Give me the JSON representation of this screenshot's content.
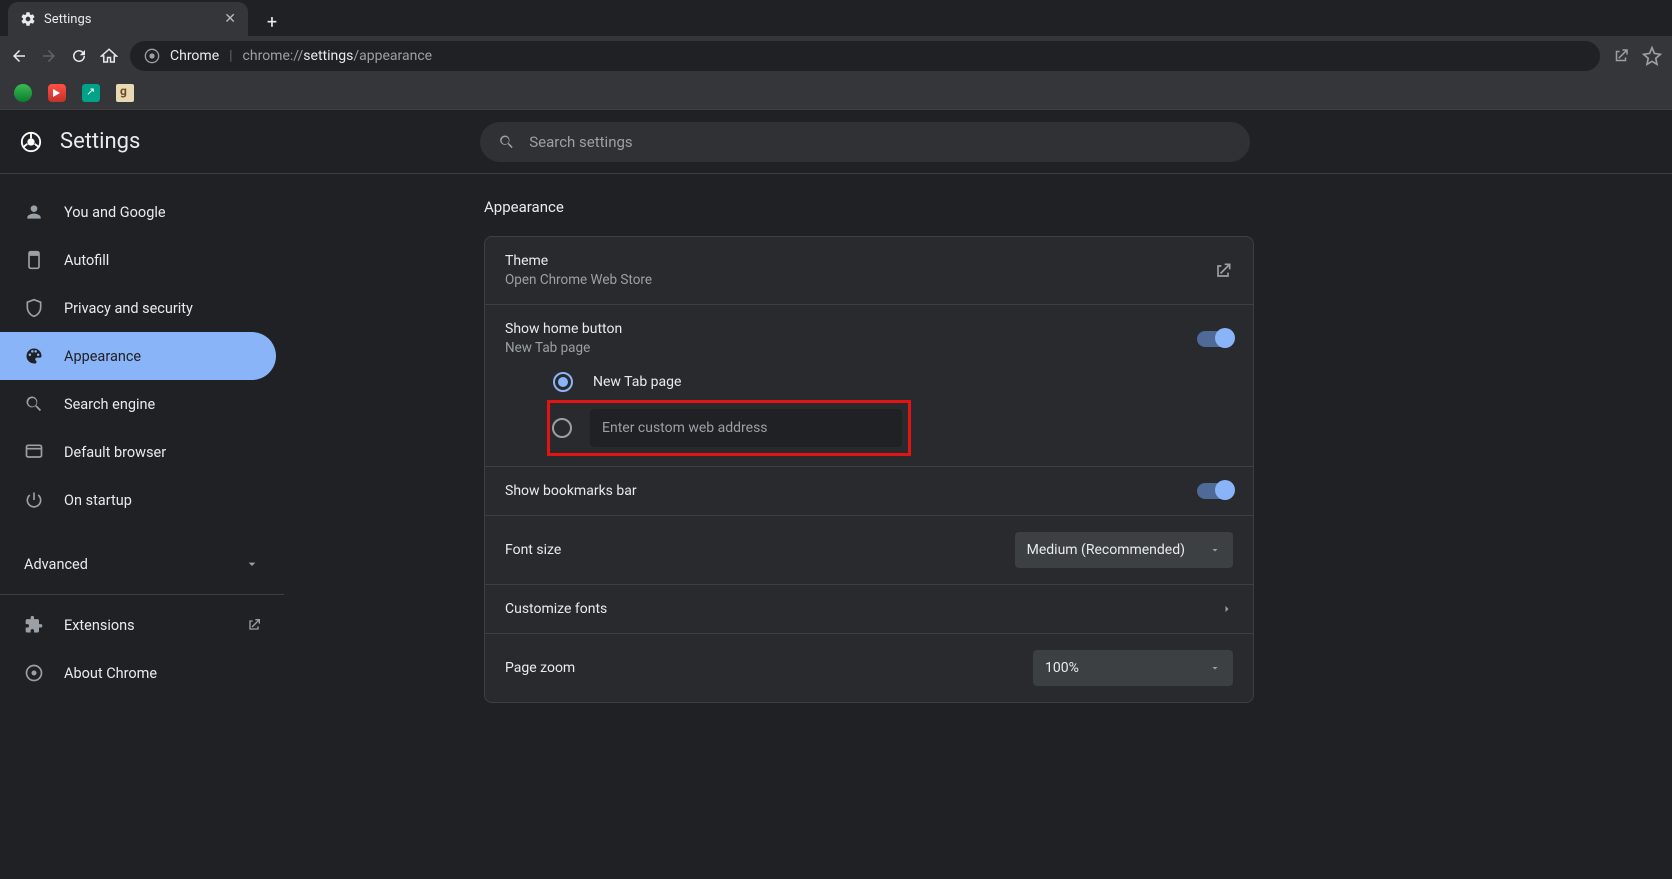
{
  "browser": {
    "tab_title": "Settings",
    "omnibox": {
      "label": "Chrome",
      "prefix": "chrome://",
      "mid": "settings",
      "suffix": "/appearance"
    }
  },
  "header": {
    "title": "Settings",
    "search_placeholder": "Search settings"
  },
  "sidebar": {
    "items": [
      {
        "label": "You and Google"
      },
      {
        "label": "Autofill"
      },
      {
        "label": "Privacy and security"
      },
      {
        "label": "Appearance"
      },
      {
        "label": "Search engine"
      },
      {
        "label": "Default browser"
      },
      {
        "label": "On startup"
      }
    ],
    "advanced": "Advanced",
    "extensions": "Extensions",
    "about": "About Chrome"
  },
  "content": {
    "section_title": "Appearance",
    "theme": {
      "title": "Theme",
      "sub": "Open Chrome Web Store"
    },
    "home_button": {
      "title": "Show home button",
      "sub": "New Tab page",
      "radio_new_tab": "New Tab page",
      "custom_placeholder": "Enter custom web address"
    },
    "bookmarks_bar": "Show bookmarks bar",
    "font_size": {
      "title": "Font size",
      "value": "Medium (Recommended)"
    },
    "customize_fonts": "Customize fonts",
    "page_zoom": {
      "title": "Page zoom",
      "value": "100%"
    }
  }
}
